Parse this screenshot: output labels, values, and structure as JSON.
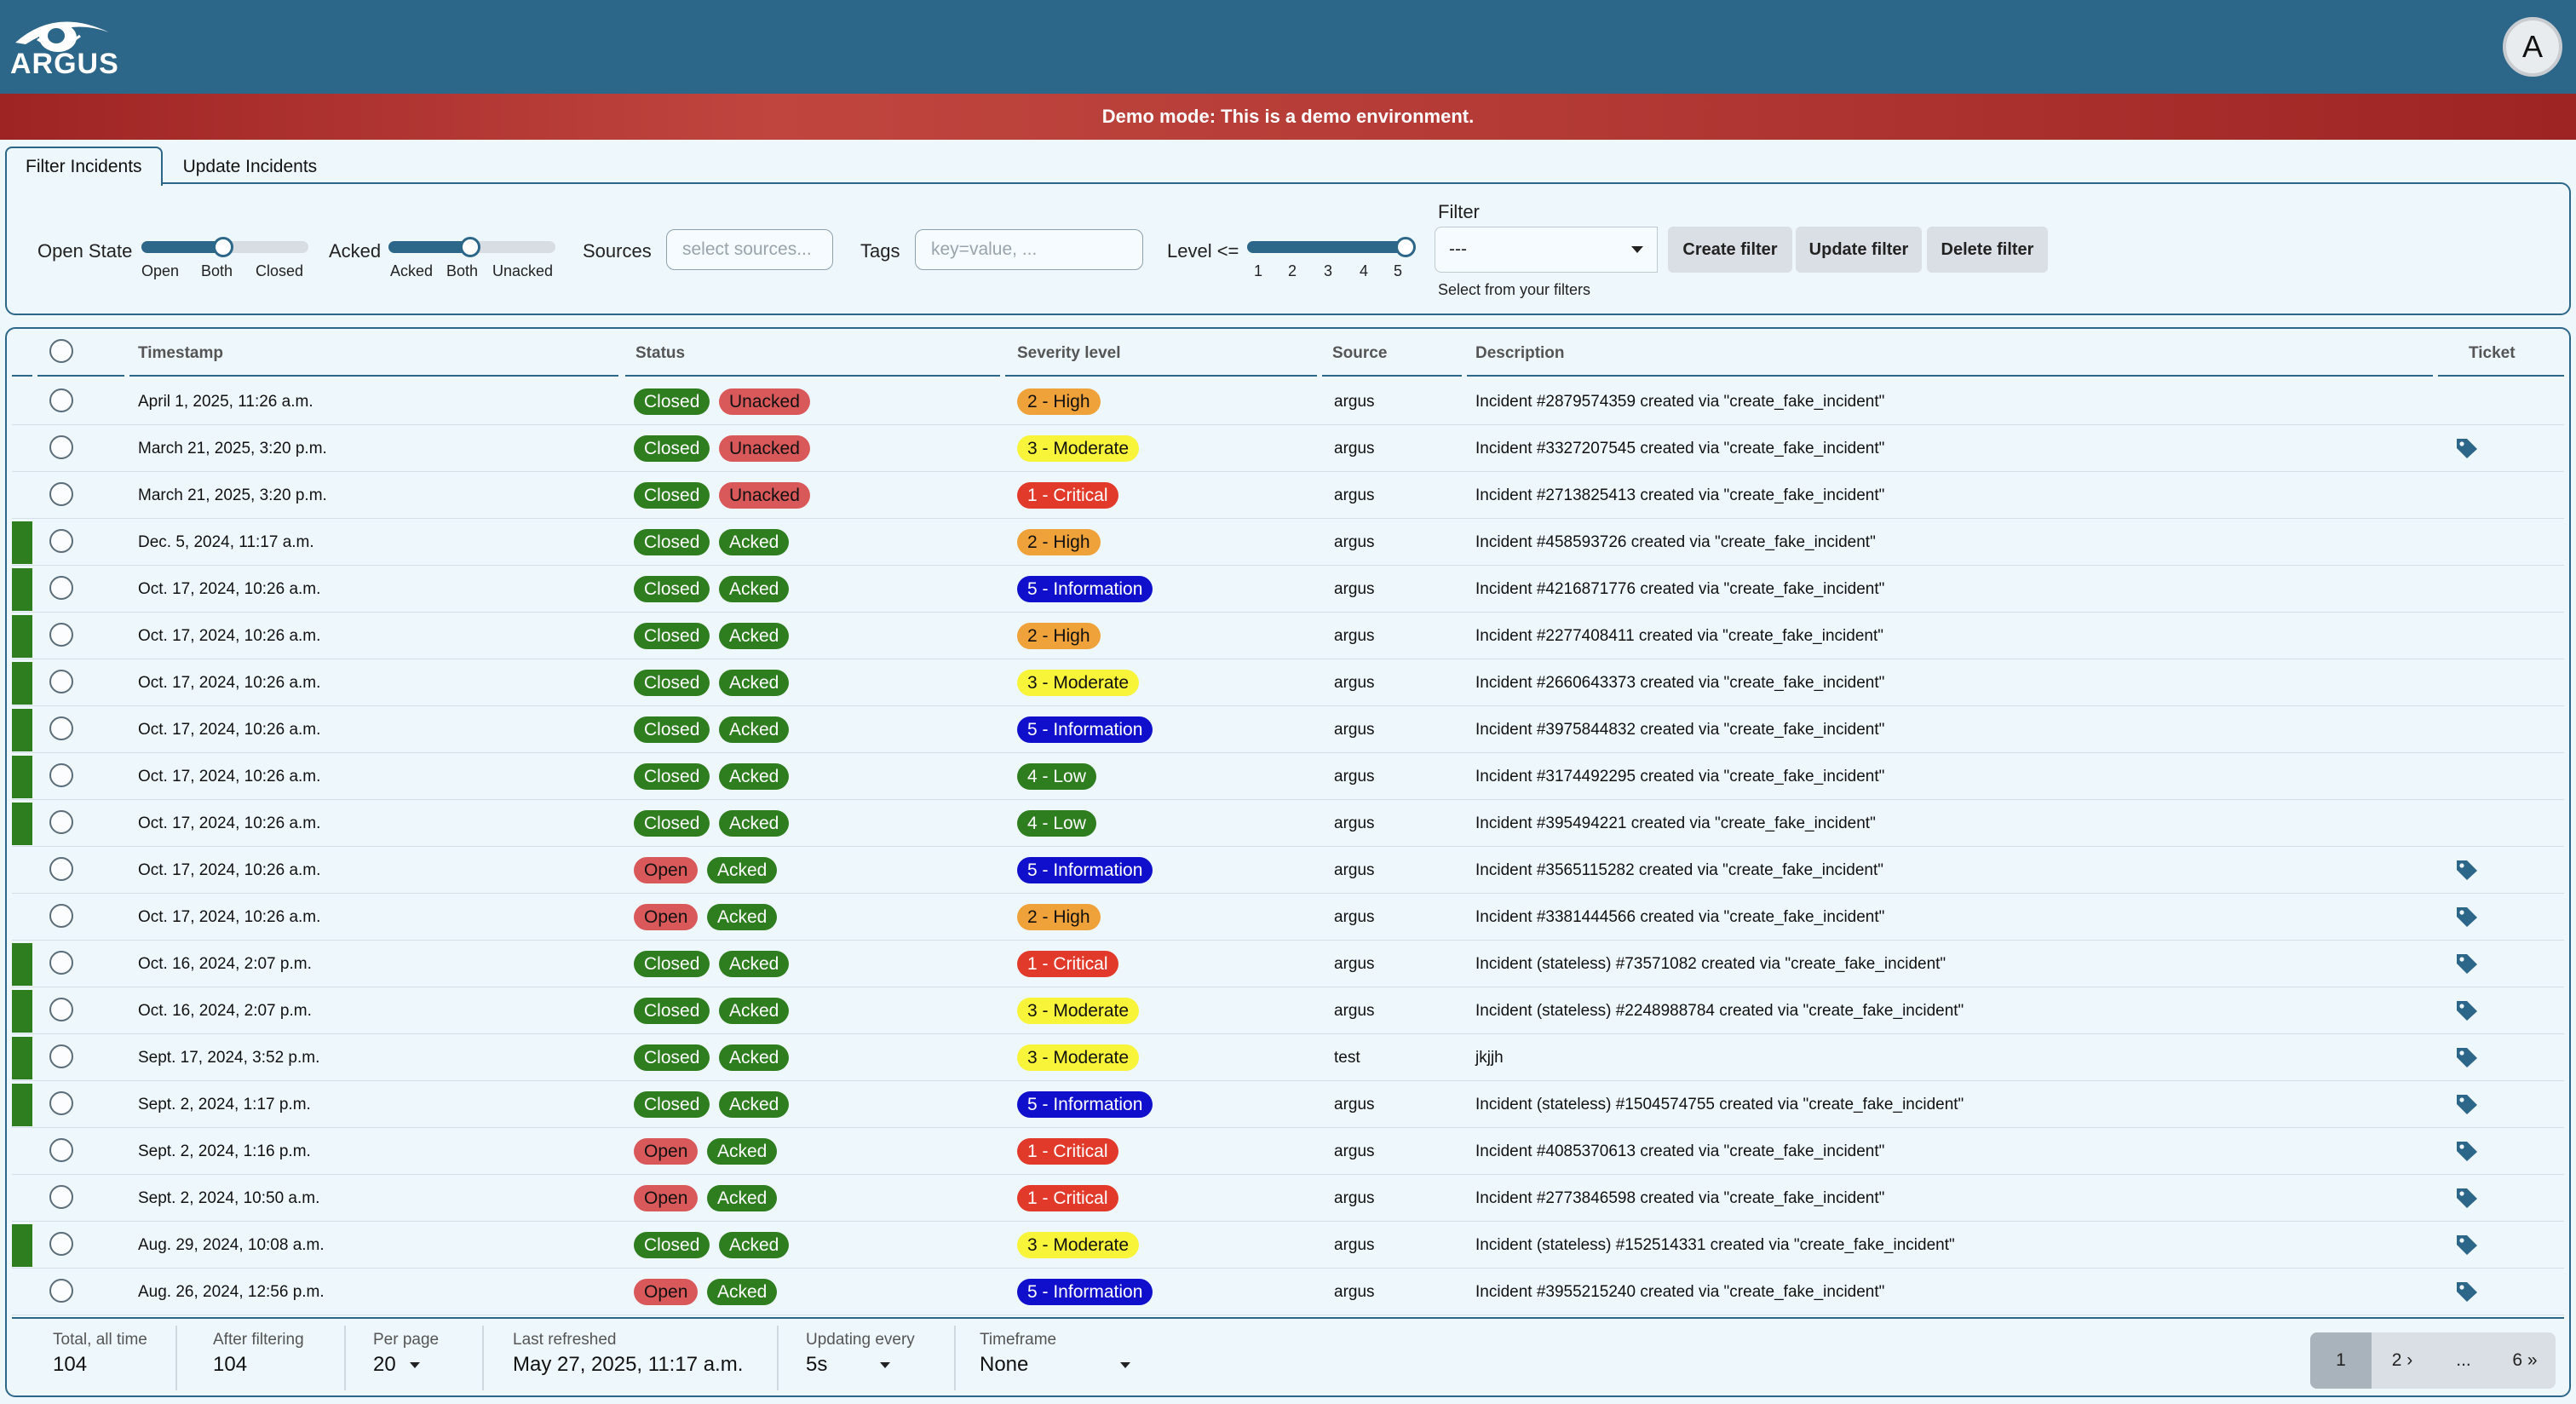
{
  "header": {
    "logo_text": "ARGUS",
    "avatar_letter": "A"
  },
  "banner": "Demo mode: This is a demo environment.",
  "tabs": [
    {
      "label": "Filter Incidents"
    },
    {
      "label": "Update Incidents"
    }
  ],
  "filters": {
    "open_state": {
      "label": "Open State",
      "options": [
        "Open",
        "Both",
        "Closed"
      ],
      "selected": "Both"
    },
    "acked": {
      "label": "Acked",
      "options": [
        "Acked",
        "Both",
        "Unacked"
      ],
      "selected": "Both"
    },
    "sources": {
      "label": "Sources",
      "placeholder": "select sources..."
    },
    "tags": {
      "label": "Tags",
      "placeholder": "key=value, ..."
    },
    "level": {
      "label": "Level <=",
      "ticks": [
        "1",
        "2",
        "3",
        "4",
        "5"
      ],
      "value": 5
    },
    "filter": {
      "label": "Filter",
      "selected": "---",
      "helper": "Select from your filters"
    },
    "buttons": {
      "create": "Create filter",
      "update": "Update filter",
      "delete": "Delete filter"
    }
  },
  "table": {
    "columns": [
      "Timestamp",
      "Status",
      "Severity level",
      "Source",
      "Description",
      "Ticket"
    ],
    "rows": [
      {
        "ts": "April 1, 2025, 11:26 a.m.",
        "open": "Closed",
        "ack": "Unacked",
        "sev": "2 - High",
        "src": "argus",
        "desc": "Incident #2879574359 created via \"create_fake_incident\"",
        "bar": false,
        "ticket": false
      },
      {
        "ts": "March 21, 2025, 3:20 p.m.",
        "open": "Closed",
        "ack": "Unacked",
        "sev": "3 - Moderate",
        "src": "argus",
        "desc": "Incident #3327207545 created via \"create_fake_incident\"",
        "bar": false,
        "ticket": true
      },
      {
        "ts": "March 21, 2025, 3:20 p.m.",
        "open": "Closed",
        "ack": "Unacked",
        "sev": "1 - Critical",
        "src": "argus",
        "desc": "Incident #2713825413 created via \"create_fake_incident\"",
        "bar": false,
        "ticket": false
      },
      {
        "ts": "Dec. 5, 2024, 11:17 a.m.",
        "open": "Closed",
        "ack": "Acked",
        "sev": "2 - High",
        "src": "argus",
        "desc": "Incident #458593726 created via \"create_fake_incident\"",
        "bar": true,
        "ticket": false
      },
      {
        "ts": "Oct. 17, 2024, 10:26 a.m.",
        "open": "Closed",
        "ack": "Acked",
        "sev": "5 - Information",
        "src": "argus",
        "desc": "Incident #4216871776 created via \"create_fake_incident\"",
        "bar": true,
        "ticket": false
      },
      {
        "ts": "Oct. 17, 2024, 10:26 a.m.",
        "open": "Closed",
        "ack": "Acked",
        "sev": "2 - High",
        "src": "argus",
        "desc": "Incident #2277408411 created via \"create_fake_incident\"",
        "bar": true,
        "ticket": false
      },
      {
        "ts": "Oct. 17, 2024, 10:26 a.m.",
        "open": "Closed",
        "ack": "Acked",
        "sev": "3 - Moderate",
        "src": "argus",
        "desc": "Incident #2660643373 created via \"create_fake_incident\"",
        "bar": true,
        "ticket": false
      },
      {
        "ts": "Oct. 17, 2024, 10:26 a.m.",
        "open": "Closed",
        "ack": "Acked",
        "sev": "5 - Information",
        "src": "argus",
        "desc": "Incident #3975844832 created via \"create_fake_incident\"",
        "bar": true,
        "ticket": false
      },
      {
        "ts": "Oct. 17, 2024, 10:26 a.m.",
        "open": "Closed",
        "ack": "Acked",
        "sev": "4 - Low",
        "src": "argus",
        "desc": "Incident #3174492295 created via \"create_fake_incident\"",
        "bar": true,
        "ticket": false
      },
      {
        "ts": "Oct. 17, 2024, 10:26 a.m.",
        "open": "Closed",
        "ack": "Acked",
        "sev": "4 - Low",
        "src": "argus",
        "desc": "Incident #395494221 created via \"create_fake_incident\"",
        "bar": true,
        "ticket": false
      },
      {
        "ts": "Oct. 17, 2024, 10:26 a.m.",
        "open": "Open",
        "ack": "Acked",
        "sev": "5 - Information",
        "src": "argus",
        "desc": "Incident #3565115282 created via \"create_fake_incident\"",
        "bar": false,
        "ticket": true
      },
      {
        "ts": "Oct. 17, 2024, 10:26 a.m.",
        "open": "Open",
        "ack": "Acked",
        "sev": "2 - High",
        "src": "argus",
        "desc": "Incident #3381444566 created via \"create_fake_incident\"",
        "bar": false,
        "ticket": true
      },
      {
        "ts": "Oct. 16, 2024, 2:07 p.m.",
        "open": "Closed",
        "ack": "Acked",
        "sev": "1 - Critical",
        "src": "argus",
        "desc": "Incident (stateless) #73571082 created via \"create_fake_incident\"",
        "bar": true,
        "ticket": true
      },
      {
        "ts": "Oct. 16, 2024, 2:07 p.m.",
        "open": "Closed",
        "ack": "Acked",
        "sev": "3 - Moderate",
        "src": "argus",
        "desc": "Incident (stateless) #2248988784 created via \"create_fake_incident\"",
        "bar": true,
        "ticket": true
      },
      {
        "ts": "Sept. 17, 2024, 3:52 p.m.",
        "open": "Closed",
        "ack": "Acked",
        "sev": "3 - Moderate",
        "src": "test",
        "desc": "jkjjh",
        "bar": true,
        "ticket": true
      },
      {
        "ts": "Sept. 2, 2024, 1:17 p.m.",
        "open": "Closed",
        "ack": "Acked",
        "sev": "5 - Information",
        "src": "argus",
        "desc": "Incident (stateless) #1504574755 created via \"create_fake_incident\"",
        "bar": true,
        "ticket": true
      },
      {
        "ts": "Sept. 2, 2024, 1:16 p.m.",
        "open": "Open",
        "ack": "Acked",
        "sev": "1 - Critical",
        "src": "argus",
        "desc": "Incident #4085370613 created via \"create_fake_incident\"",
        "bar": false,
        "ticket": true
      },
      {
        "ts": "Sept. 2, 2024, 10:50 a.m.",
        "open": "Open",
        "ack": "Acked",
        "sev": "1 - Critical",
        "src": "argus",
        "desc": "Incident #2773846598 created via \"create_fake_incident\"",
        "bar": false,
        "ticket": true
      },
      {
        "ts": "Aug. 29, 2024, 10:08 a.m.",
        "open": "Closed",
        "ack": "Acked",
        "sev": "3 - Moderate",
        "src": "argus",
        "desc": "Incident (stateless) #152514331 created via \"create_fake_incident\"",
        "bar": true,
        "ticket": true
      },
      {
        "ts": "Aug. 26, 2024, 12:56 p.m.",
        "open": "Open",
        "ack": "Acked",
        "sev": "5 - Information",
        "src": "argus",
        "desc": "Incident #3955215240 created via \"create_fake_incident\"",
        "bar": false,
        "ticket": true
      }
    ]
  },
  "footer": {
    "total": {
      "label": "Total, all time",
      "value": "104"
    },
    "after": {
      "label": "After filtering",
      "value": "104"
    },
    "per_page": {
      "label": "Per page",
      "value": "20"
    },
    "refreshed": {
      "label": "Last refreshed",
      "value": "May 27, 2025, 11:17 a.m."
    },
    "updating": {
      "label": "Updating every",
      "value": "5s"
    },
    "timeframe": {
      "label": "Timeframe",
      "value": "None"
    },
    "pages": [
      "1",
      "2 ›",
      "...",
      "6 »"
    ]
  },
  "colors": {
    "header": "#2c6689",
    "closed": "#2e7d1f",
    "open": "#d9595a",
    "unacked": "#d9595a",
    "acked": "#2e7d1f",
    "sev1": "#e23a2a",
    "sev2": "#f0a23a",
    "sev3": "#f7f43a",
    "sev4": "#2e7d1f",
    "sev5": "#1010cc"
  }
}
